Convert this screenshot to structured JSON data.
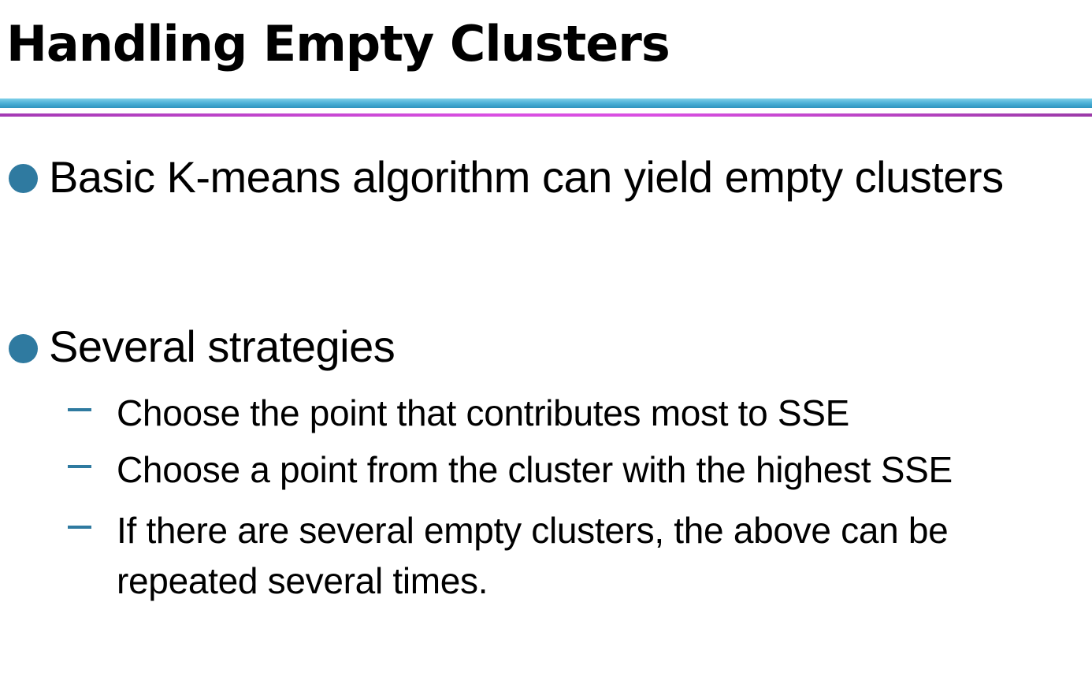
{
  "slide": {
    "title": "Handling Empty Clusters",
    "bullets": [
      {
        "text": "Basic K-means algorithm can yield empty clusters"
      },
      {
        "text": "Several strategies"
      }
    ],
    "subpoints": [
      {
        "text": "Choose the point that contributes most to SSE"
      },
      {
        "text": "Choose a point from the cluster with the highest SSE"
      },
      {
        "text": "If there are several empty clusters, the above can be repeated several times."
      }
    ],
    "colors": {
      "bullet": "#2f7aa0",
      "rule_blue": "#4bb0d6",
      "rule_magenta": "#d94fe2"
    }
  }
}
